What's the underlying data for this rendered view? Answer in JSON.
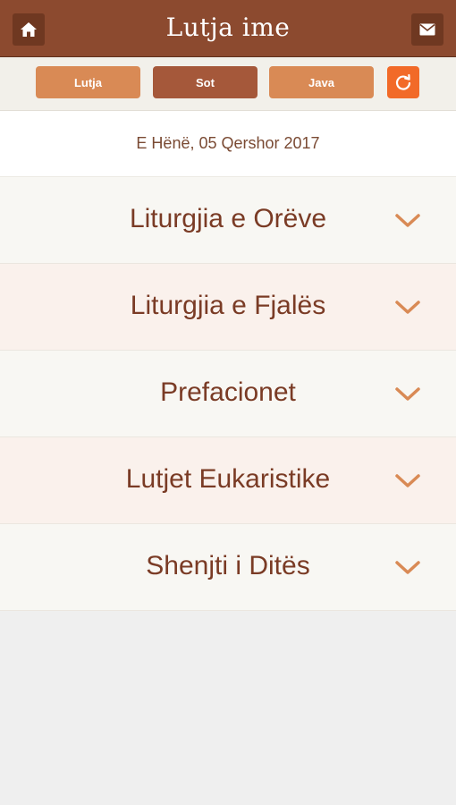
{
  "header": {
    "title": "Lutja  ime",
    "home_icon": "home-icon",
    "mail_icon": "envelope-icon"
  },
  "toolbar": {
    "tabs": [
      {
        "label": "Lutja"
      },
      {
        "label": "Sot"
      },
      {
        "label": "Java"
      }
    ],
    "refresh_icon": "refresh-icon"
  },
  "date": "E Hënë, 05 Qershor 2017",
  "sections": [
    {
      "label": "Liturgjia e Orëve"
    },
    {
      "label": "Liturgjia e Fjalës"
    },
    {
      "label": "Prefacionet"
    },
    {
      "label": "Lutjet Eukaristike"
    },
    {
      "label": "Shenjti i Ditës"
    }
  ],
  "colors": {
    "header": "#8c4a2f",
    "tab": "#d98a55",
    "tab_active": "#a5583a",
    "refresh": "#f26a28",
    "text": "#7a3b25",
    "chevron": "#d98a55"
  }
}
